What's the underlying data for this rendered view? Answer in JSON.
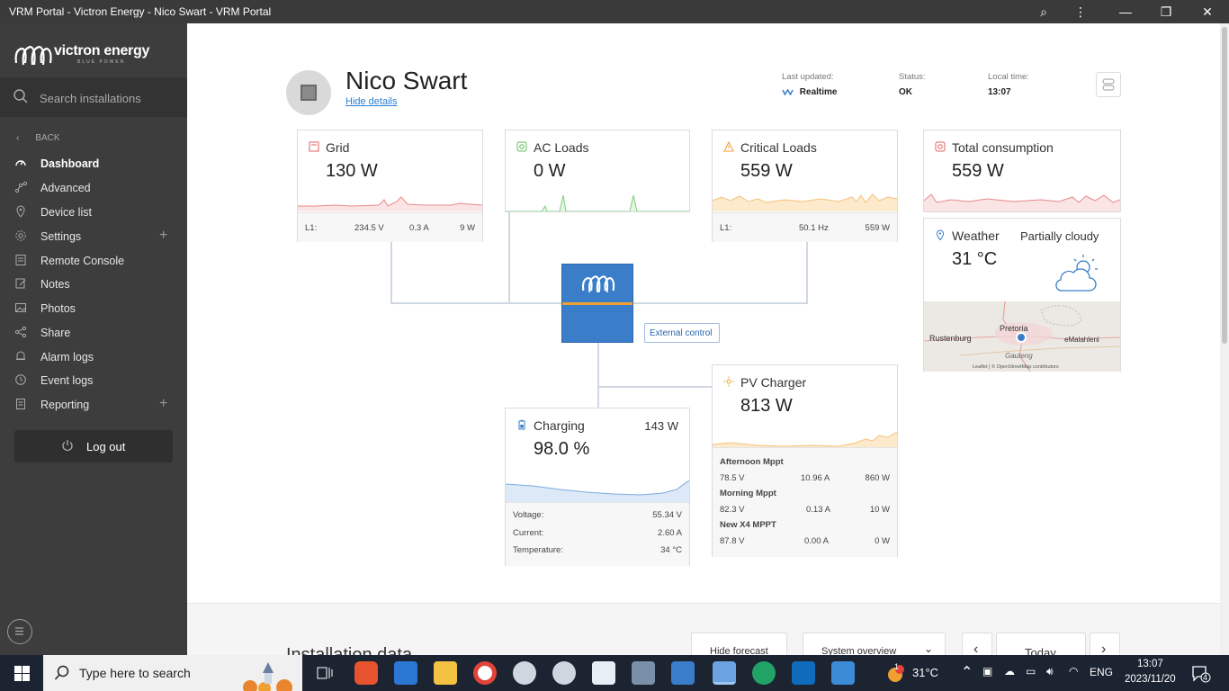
{
  "window": {
    "title": "VRM Portal - Victron Energy - Nico Swart - VRM Portal"
  },
  "sidebar": {
    "brand": "victron energy",
    "brand_sub": "BLUE POWER",
    "search_placeholder": "Search installations",
    "back_label": "BACK",
    "items": [
      {
        "label": "Dashboard",
        "active": true
      },
      {
        "label": "Advanced"
      },
      {
        "label": "Device list"
      },
      {
        "label": "Settings",
        "expandable": true
      },
      {
        "label": "Remote Console"
      },
      {
        "label": "Notes"
      },
      {
        "label": "Photos"
      },
      {
        "label": "Share"
      },
      {
        "label": "Alarm logs"
      },
      {
        "label": "Event logs"
      },
      {
        "label": "Reporting",
        "expandable": true
      }
    ],
    "logout_label": "Log out"
  },
  "header": {
    "name": "Nico Swart",
    "hide_details": "Hide details",
    "last_updated_label": "Last updated:",
    "last_updated_value": "Realtime",
    "status_label": "Status:",
    "status_value": "OK",
    "local_time_label": "Local time:",
    "local_time_value": "13:07"
  },
  "cards": {
    "grid": {
      "title": "Grid",
      "value": "130 W",
      "foot": {
        "phase": "L1:",
        "voltage": "234.5 V",
        "current": "0.3 A",
        "power": "9 W"
      }
    },
    "ac_loads": {
      "title": "AC Loads",
      "value": "0 W"
    },
    "critical_loads": {
      "title": "Critical Loads",
      "value": "559 W",
      "foot": {
        "phase": "L1:",
        "freq": "50.1 Hz",
        "power": "559 W"
      }
    },
    "total_consumption": {
      "title": "Total consumption",
      "value": "559 W"
    },
    "weather": {
      "title": "Weather",
      "condition": "Partially cloudy",
      "temp": "31 °C",
      "map_labels": {
        "rustenburg": "Rustenburg",
        "pretoria": "Pretoria",
        "emalahleni": "eMalahleni",
        "gauteng": "Gauteng",
        "attribution": "Leaflet | © OpenStreetMap contributors"
      }
    },
    "external_control": "External control",
    "battery": {
      "title": "Charging",
      "power": "143 W",
      "value": "98.0 %",
      "rows": [
        {
          "label": "Voltage:",
          "value": "55.34 V"
        },
        {
          "label": "Current:",
          "value": "2.60 A"
        },
        {
          "label": "Temperature:",
          "value": "34 °C"
        }
      ]
    },
    "pv": {
      "title": "PV Charger",
      "value": "813 W",
      "mppts": [
        {
          "name": "Afternoon Mppt",
          "voltage": "78.5 V",
          "current": "10.96 A",
          "power": "860 W"
        },
        {
          "name": "Morning Mppt",
          "voltage": "82.3 V",
          "current": "0.13 A",
          "power": "10 W"
        },
        {
          "name": "New X4 MPPT",
          "voltage": "87.8 V",
          "current": "0.00 A",
          "power": "0 W"
        }
      ]
    }
  },
  "bottom": {
    "section_title": "Installation data",
    "hide_forecast": "Hide forecast",
    "view_select": "System overview",
    "period": "Today"
  },
  "taskbar": {
    "search_placeholder": "Type here to search",
    "weather": "31°C",
    "lang": "ENG",
    "time": "13:07",
    "date": "2023/11/20",
    "notifications": "4",
    "outlook_badge": "1"
  },
  "colors": {
    "sidebar_bg": "#3d3d3d",
    "accent_blue": "#3a7dc9",
    "accent_orange": "#f0a030",
    "grid_red": "#e06060",
    "ac_green": "#5cbd5c"
  }
}
